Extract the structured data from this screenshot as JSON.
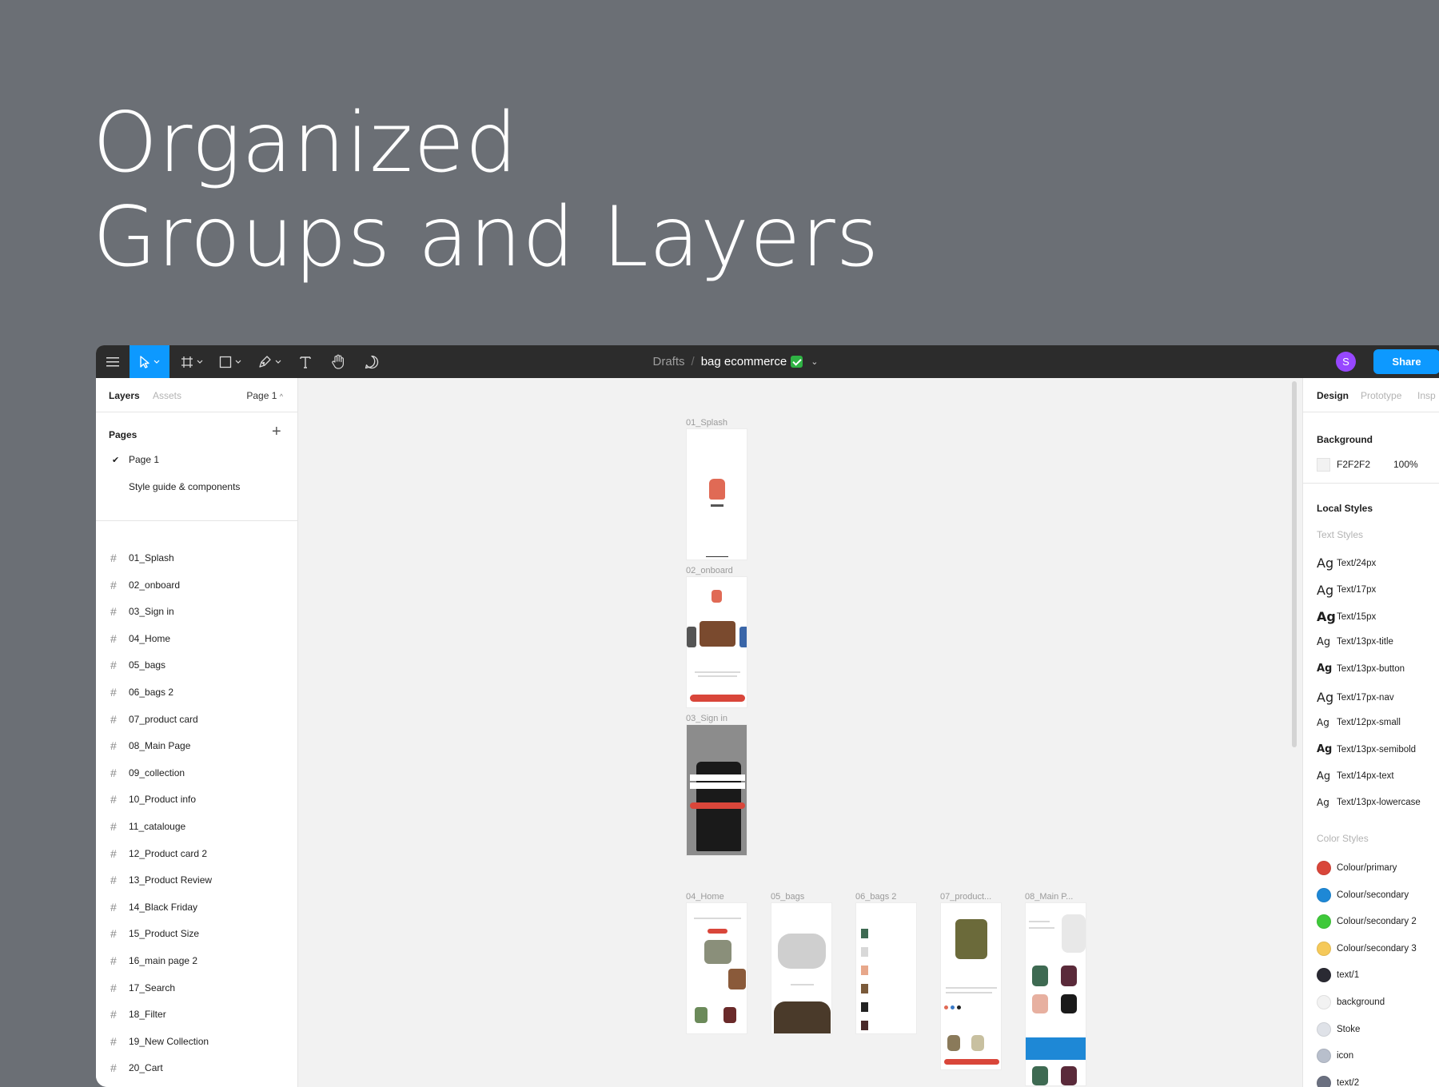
{
  "hero": {
    "line1": "Organized",
    "line2": "Groups and Layers"
  },
  "toolbar": {
    "breadcrumb_root": "Drafts",
    "breadcrumb_sep": "/",
    "file_name": "bag ecommerce",
    "avatar_initial": "S",
    "share_label": "Share"
  },
  "left_panel": {
    "tab_layers": "Layers",
    "tab_assets": "Assets",
    "page_selector": "Page 1",
    "pages_heading": "Pages",
    "pages": [
      "Page 1",
      "Style guide & components"
    ],
    "layers": [
      "01_Splash",
      "02_onboard",
      "03_Sign in",
      "04_Home",
      "05_bags",
      "06_bags 2",
      "07_product card",
      "08_Main Page",
      "09_collection",
      "10_Product info",
      "11_catalouge",
      "12_Product card 2",
      "13_Product Review",
      "14_Black Friday",
      "15_Product Size",
      "16_main page 2",
      "17_Search",
      "18_Filter",
      "19_New Collection",
      "20_Cart"
    ]
  },
  "canvas": {
    "frames": [
      "01_Splash",
      "02_onboard",
      "03_Sign in",
      "04_Home",
      "05_bags",
      "06_bags 2",
      "07_product...",
      "08_Main P..."
    ]
  },
  "right_panel": {
    "tab_design": "Design",
    "tab_prototype": "Prototype",
    "tab_inspect": "Insp",
    "background_heading": "Background",
    "background_hex": "F2F2F2",
    "background_opacity": "100%",
    "local_styles_heading": "Local Styles",
    "text_styles_heading": "Text Styles",
    "ag_glyph": "Ag",
    "text_styles": [
      "Text/24px",
      "Text/17px",
      "Text/15px",
      "Text/13px-title",
      "Text/13px-button",
      "Text/17px-nav",
      "Text/12px-small",
      "Text/13px-semibold",
      "Text/14px-text",
      "Text/13px-lowercase"
    ],
    "color_styles_heading": "Color Styles",
    "color_styles": [
      {
        "name": "Colour/primary",
        "color": "#d9463a"
      },
      {
        "name": "Colour/secondary",
        "color": "#1e88d6"
      },
      {
        "name": "Colour/secondary 2",
        "color": "#3fc93a"
      },
      {
        "name": "Colour/secondary 3",
        "color": "#f5c95a"
      },
      {
        "name": "text/1",
        "color": "#2a2a33"
      },
      {
        "name": "background",
        "color": "#f2f2f2"
      },
      {
        "name": "Stoke",
        "color": "#dfe2e8"
      },
      {
        "name": "icon",
        "color": "#b8bfcc"
      },
      {
        "name": "text/2",
        "color": "#6b7080"
      }
    ]
  },
  "colors": {
    "toolbar_bg": "#2c2c2c",
    "accent": "#0d99ff",
    "avatar": "#9747ff",
    "brand_red": "#d9463a"
  }
}
